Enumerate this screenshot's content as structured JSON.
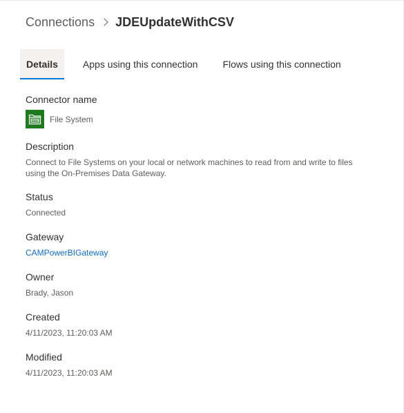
{
  "breadcrumb": {
    "parent": "Connections",
    "current": "JDEUpdateWithCSV"
  },
  "tabs": [
    {
      "label": "Details",
      "active": true
    },
    {
      "label": "Apps using this connection",
      "active": false
    },
    {
      "label": "Flows using this connection",
      "active": false
    }
  ],
  "details": {
    "connector": {
      "label": "Connector name",
      "name": "File System",
      "icon": "folder-icon",
      "icon_color": "#1e7a1e"
    },
    "description": {
      "label": "Description",
      "text": "Connect to File Systems on your local or network machines to read from and write to files using the On-Premises Data Gateway."
    },
    "status": {
      "label": "Status",
      "value": "Connected"
    },
    "gateway": {
      "label": "Gateway",
      "value": "CAMPowerBIGateway"
    },
    "owner": {
      "label": "Owner",
      "value": "Brady, Jason"
    },
    "created": {
      "label": "Created",
      "value": "4/11/2023, 11:20:03 AM"
    },
    "modified": {
      "label": "Modified",
      "value": "4/11/2023, 11:20:03 AM"
    }
  },
  "colors": {
    "accent": "#0078d4",
    "link": "#0f6cbd"
  }
}
